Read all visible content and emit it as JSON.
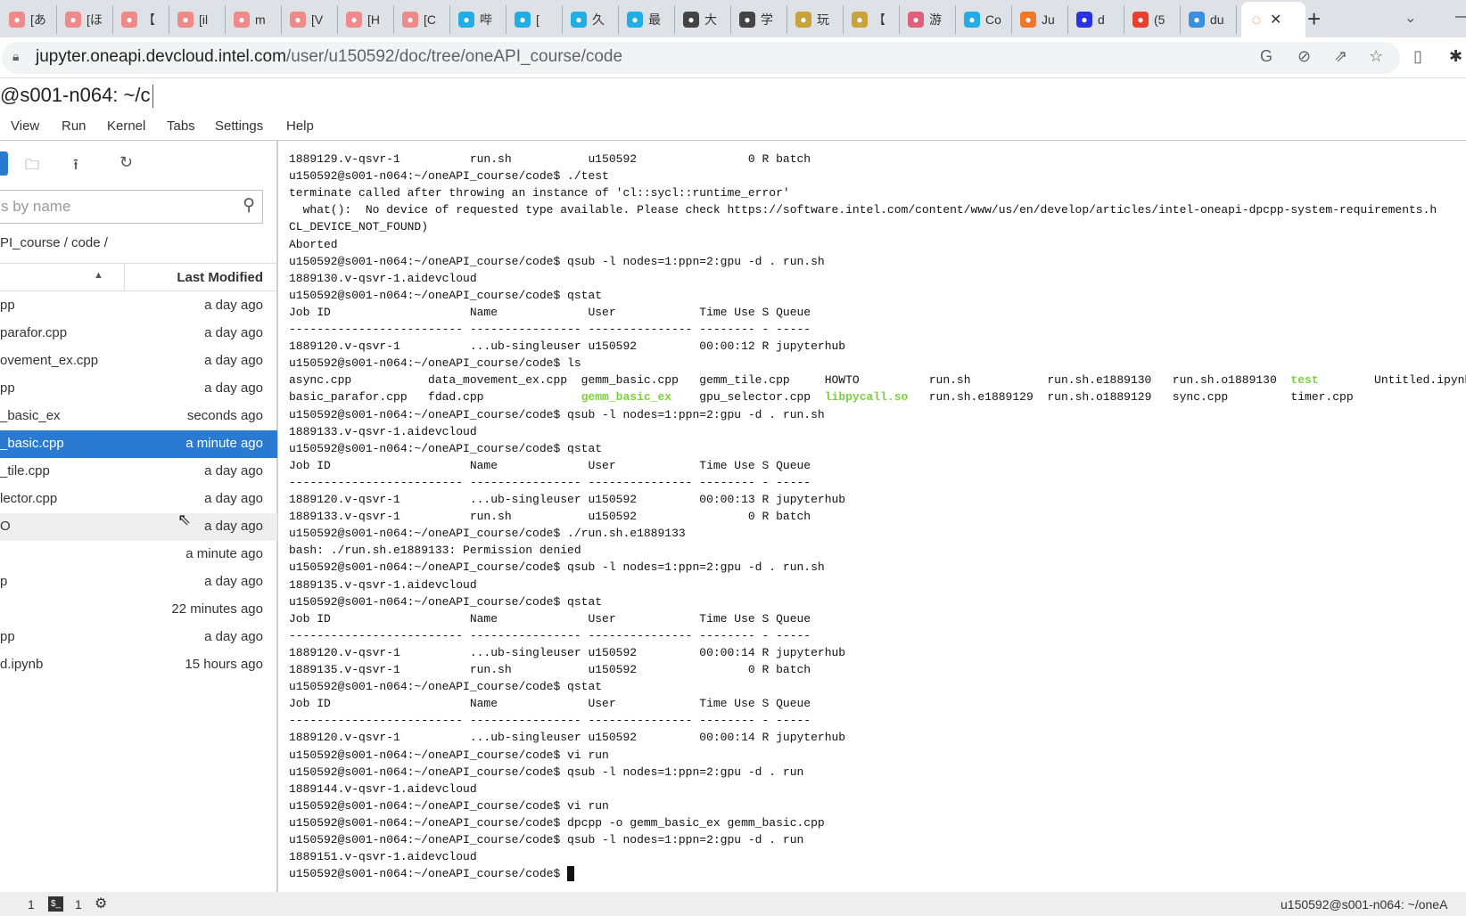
{
  "browser": {
    "tabs": [
      {
        "icon": "paw-icon",
        "label": "[あ",
        "color": "#f08a8a"
      },
      {
        "icon": "paw-icon",
        "label": "[ほ",
        "color": "#f08a8a"
      },
      {
        "icon": "paw-icon",
        "label": "【",
        "color": "#f08a8a"
      },
      {
        "icon": "paw-icon",
        "label": "[il",
        "color": "#f08a8a"
      },
      {
        "icon": "paw-icon",
        "label": "m",
        "color": "#f08a8a"
      },
      {
        "icon": "paw-icon",
        "label": "[V",
        "color": "#f08a8a"
      },
      {
        "icon": "paw-icon",
        "label": "[H",
        "color": "#f08a8a"
      },
      {
        "icon": "paw-icon",
        "label": "[C",
        "color": "#f08a8a"
      },
      {
        "icon": "bilibili-icon",
        "label": "哔",
        "color": "#23ade5"
      },
      {
        "icon": "bilibili-icon",
        "label": "[",
        "color": "#23ade5"
      },
      {
        "icon": "bilibili-icon",
        "label": "久",
        "color": "#23ade5"
      },
      {
        "icon": "bilibili-icon",
        "label": "最",
        "color": "#23ade5"
      },
      {
        "icon": "globe-icon",
        "label": "大",
        "color": "#444444"
      },
      {
        "icon": "globe-icon",
        "label": "学",
        "color": "#444444"
      },
      {
        "icon": "bird-icon",
        "label": "玩",
        "color": "#c9a23a"
      },
      {
        "icon": "bird-icon",
        "label": "【",
        "color": "#c9a23a"
      },
      {
        "icon": "anime-icon",
        "label": "游",
        "color": "#e0607a"
      },
      {
        "icon": "bilibili-icon",
        "label": "Co",
        "color": "#23ade5"
      },
      {
        "icon": "jupyter-icon",
        "label": "Ju",
        "color": "#f37626"
      },
      {
        "icon": "baidu-icon",
        "label": "d",
        "color": "#2932e1"
      },
      {
        "icon": "csdn-icon",
        "label": "(5",
        "color": "#e8402c"
      },
      {
        "icon": "app-icon",
        "label": "du",
        "color": "#3b8fe0"
      }
    ],
    "active_tab_icon": "jupyter-icon",
    "url_host": "jupyter.oneapi.devcloud.intel.com",
    "url_path": "/user/u150592/doc/tree/oneAPI_course/code"
  },
  "jupyter": {
    "title": "@s001-n064: ~/c",
    "menu": [
      "View",
      "Run",
      "Kernel",
      "Tabs",
      "Settings",
      "Help"
    ],
    "search_placeholder": "s by name",
    "breadcrumb": "PI_course / code /",
    "column_modified": "Last Modified",
    "files": [
      {
        "name": "pp",
        "modified": "a day ago"
      },
      {
        "name": "parafor.cpp",
        "modified": "a day ago"
      },
      {
        "name": "ovement_ex.cpp",
        "modified": "a day ago"
      },
      {
        "name": "pp",
        "modified": "a day ago"
      },
      {
        "name": "_basic_ex",
        "modified": "seconds ago"
      },
      {
        "name": "_basic.cpp",
        "modified": "a minute ago",
        "selected": true
      },
      {
        "name": "_tile.cpp",
        "modified": "a day ago"
      },
      {
        "name": "lector.cpp",
        "modified": "a day ago"
      },
      {
        "name": "O",
        "modified": "a day ago",
        "hover": true
      },
      {
        "name": "",
        "modified": "a minute ago"
      },
      {
        "name": "p",
        "modified": "a day ago"
      },
      {
        "name": "",
        "modified": "22 minutes ago"
      },
      {
        "name": "pp",
        "modified": "a day ago"
      },
      {
        "name": "d.ipynb",
        "modified": "15 hours ago"
      }
    ],
    "terminal": [
      [
        {
          "t": "1889129.v-qsvr-1          run.sh           u150592                0 R batch"
        }
      ],
      [
        {
          "t": "u150592@s001-n064:~/oneAPI_course/code$ ./test"
        }
      ],
      [
        {
          "t": "terminate called after throwing an instance of 'cl::sycl::runtime_error'"
        }
      ],
      [
        {
          "t": "  what():  No device of requested type available. Please check https://software.intel.com/content/www/us/en/develop/articles/intel-oneapi-dpcpp-system-requirements.h"
        }
      ],
      [
        {
          "t": "CL_DEVICE_NOT_FOUND)"
        }
      ],
      [
        {
          "t": "Aborted"
        }
      ],
      [
        {
          "t": "u150592@s001-n064:~/oneAPI_course/code$ qsub -l nodes=1:ppn=2:gpu -d . run.sh"
        }
      ],
      [
        {
          "t": "1889130.v-qsvr-1.aidevcloud"
        }
      ],
      [
        {
          "t": "u150592@s001-n064:~/oneAPI_course/code$ qstat"
        }
      ],
      [
        {
          "t": "Job ID                    Name             User            Time Use S Queue"
        }
      ],
      [
        {
          "t": "------------------------- ---------------- --------------- -------- - -----"
        }
      ],
      [
        {
          "t": "1889120.v-qsvr-1          ...ub-singleuser u150592         00:00:12 R jupyterhub"
        }
      ],
      [
        {
          "t": "u150592@s001-n064:~/oneAPI_course/code$ ls"
        }
      ],
      [
        {
          "t": "async.cpp           data_movement_ex.cpp  gemm_basic.cpp   gemm_tile.cpp     HOWTO          run.sh           run.sh.e1889130   run.sh.o1889130  "
        },
        {
          "t": "test",
          "g": true
        },
        {
          "t": "        Untitled.ipynb"
        }
      ],
      [
        {
          "t": "basic_parafor.cpp   fdad.cpp              "
        },
        {
          "t": "gemm_basic_ex",
          "g": true
        },
        {
          "t": "    gpu_selector.cpp  "
        },
        {
          "t": "libpycall.so",
          "g": true
        },
        {
          "t": "   run.sh.e1889129  run.sh.o1889129   sync.cpp         timer.cpp"
        }
      ],
      [
        {
          "t": "u150592@s001-n064:~/oneAPI_course/code$ qsub -l nodes=1:ppn=2:gpu -d . run.sh"
        }
      ],
      [
        {
          "t": "1889133.v-qsvr-1.aidevcloud"
        }
      ],
      [
        {
          "t": "u150592@s001-n064:~/oneAPI_course/code$ qstat"
        }
      ],
      [
        {
          "t": "Job ID                    Name             User            Time Use S Queue"
        }
      ],
      [
        {
          "t": "------------------------- ---------------- --------------- -------- - -----"
        }
      ],
      [
        {
          "t": "1889120.v-qsvr-1          ...ub-singleuser u150592         00:00:13 R jupyterhub"
        }
      ],
      [
        {
          "t": "1889133.v-qsvr-1          run.sh           u150592                0 R batch"
        }
      ],
      [
        {
          "t": "u150592@s001-n064:~/oneAPI_course/code$ ./run.sh.e1889133"
        }
      ],
      [
        {
          "t": "bash: ./run.sh.e1889133: Permission denied"
        }
      ],
      [
        {
          "t": "u150592@s001-n064:~/oneAPI_course/code$ qsub -l nodes=1:ppn=2:gpu -d . run.sh"
        }
      ],
      [
        {
          "t": "1889135.v-qsvr-1.aidevcloud"
        }
      ],
      [
        {
          "t": "u150592@s001-n064:~/oneAPI_course/code$ qstat"
        }
      ],
      [
        {
          "t": "Job ID                    Name             User            Time Use S Queue"
        }
      ],
      [
        {
          "t": "------------------------- ---------------- --------------- -------- - -----"
        }
      ],
      [
        {
          "t": "1889120.v-qsvr-1          ...ub-singleuser u150592         00:00:14 R jupyterhub"
        }
      ],
      [
        {
          "t": "1889135.v-qsvr-1          run.sh           u150592                0 R batch"
        }
      ],
      [
        {
          "t": "u150592@s001-n064:~/oneAPI_course/code$ qstat"
        }
      ],
      [
        {
          "t": "Job ID                    Name             User            Time Use S Queue"
        }
      ],
      [
        {
          "t": "------------------------- ---------------- --------------- -------- - -----"
        }
      ],
      [
        {
          "t": "1889120.v-qsvr-1          ...ub-singleuser u150592         00:00:14 R jupyterhub"
        }
      ],
      [
        {
          "t": "u150592@s001-n064:~/oneAPI_course/code$ vi run"
        }
      ],
      [
        {
          "t": "u150592@s001-n064:~/oneAPI_course/code$ qsub -l nodes=1:ppn=2:gpu -d . run"
        }
      ],
      [
        {
          "t": "1889144.v-qsvr-1.aidevcloud"
        }
      ],
      [
        {
          "t": "u150592@s001-n064:~/oneAPI_course/code$ vi run"
        }
      ],
      [
        {
          "t": "u150592@s001-n064:~/oneAPI_course/code$ dpcpp -o gemm_basic_ex gemm_basic.cpp"
        }
      ],
      [
        {
          "t": "u150592@s001-n064:~/oneAPI_course/code$ qsub -l nodes=1:ppn=2:gpu -d . run"
        }
      ],
      [
        {
          "t": "1889151.v-qsvr-1.aidevcloud"
        }
      ],
      [
        {
          "t": "u150592@s001-n064:~/oneAPI_course/code$ "
        }
      ]
    ],
    "status": {
      "kernels": "1",
      "terminals": "1",
      "right_text": "u150592@s001-n064: ~/oneA"
    }
  }
}
